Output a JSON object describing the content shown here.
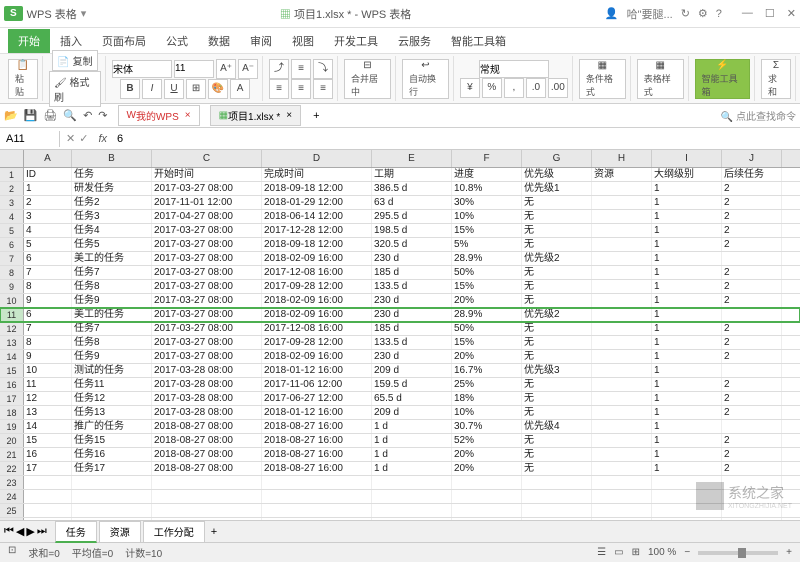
{
  "title": {
    "app_logo": "S",
    "app_name": "WPS 表格",
    "doc_title": "项目1.xlsx * - WPS 表格",
    "user_hint": "哈\"要腿..."
  },
  "menu": {
    "tabs": [
      "开始",
      "插入",
      "页面布局",
      "公式",
      "数据",
      "审阅",
      "视图",
      "开发工具",
      "云服务",
      "智能工具箱"
    ],
    "active_index": 0
  },
  "toolbar": {
    "paste": "粘贴",
    "copy": "复制",
    "format_painter": "格式刷",
    "font_name": "宋体",
    "font_size": "11",
    "merge": "合并居中",
    "wrap": "自动换行",
    "general": "常规",
    "cond_format": "条件格式",
    "table_style": "表格样式",
    "smart_tools": "智能工具箱",
    "sum": "求和"
  },
  "quickbar": {
    "home_tab": "我的WPS",
    "doc_tab": "项目1.xlsx *",
    "search_hint": "点此查找命令"
  },
  "formula_bar": {
    "cell_ref": "A11",
    "fx": "fx",
    "value": "6"
  },
  "columns": [
    "A",
    "B",
    "C",
    "D",
    "E",
    "F",
    "G",
    "H",
    "I",
    "J"
  ],
  "headers": {
    "A": "ID",
    "B": "任务",
    "C": "开始时间",
    "D": "完成时间",
    "E": "工期",
    "F": "进度",
    "G": "优先级",
    "H": "资源",
    "I": "大纲级别",
    "J": "后续任务"
  },
  "highlighted_row": 11,
  "active_cell": "A11",
  "rows": [
    {
      "A": "1",
      "B": "研发任务",
      "C": "2017-03-27 08:00",
      "D": "2018-09-18 12:00",
      "E": "386.5 d",
      "F": "10.8%",
      "G": "优先级1",
      "H": "",
      "I": "1",
      "J": "2"
    },
    {
      "A": "2",
      "B": "任务2",
      "C": "2017-11-01 12:00",
      "D": "2018-01-29 12:00",
      "E": "63 d",
      "F": "30%",
      "G": "无",
      "H": "",
      "I": "1",
      "J": "2"
    },
    {
      "A": "3",
      "B": "任务3",
      "C": "2017-04-27 08:00",
      "D": "2018-06-14 12:00",
      "E": "295.5 d",
      "F": "10%",
      "G": "无",
      "H": "",
      "I": "1",
      "J": "2"
    },
    {
      "A": "4",
      "B": "任务4",
      "C": "2017-03-27 08:00",
      "D": "2017-12-28 12:00",
      "E": "198.5 d",
      "F": "15%",
      "G": "无",
      "H": "",
      "I": "1",
      "J": "2"
    },
    {
      "A": "5",
      "B": "任务5",
      "C": "2017-03-27 08:00",
      "D": "2018-09-18 12:00",
      "E": "320.5 d",
      "F": "5%",
      "G": "无",
      "H": "",
      "I": "1",
      "J": "2"
    },
    {
      "A": "6",
      "B": "美工的任务",
      "C": "2017-03-27 08:00",
      "D": "2018-02-09 16:00",
      "E": "230 d",
      "F": "28.9%",
      "G": "优先级2",
      "H": "",
      "I": "1",
      "J": ""
    },
    {
      "A": "7",
      "B": "任务7",
      "C": "2017-03-27 08:00",
      "D": "2017-12-08 16:00",
      "E": "185 d",
      "F": "50%",
      "G": "无",
      "H": "",
      "I": "1",
      "J": "2"
    },
    {
      "A": "8",
      "B": "任务8",
      "C": "2017-03-27 08:00",
      "D": "2017-09-28 12:00",
      "E": "133.5 d",
      "F": "15%",
      "G": "无",
      "H": "",
      "I": "1",
      "J": "2"
    },
    {
      "A": "9",
      "B": "任务9",
      "C": "2017-03-27 08:00",
      "D": "2018-02-09 16:00",
      "E": "230 d",
      "F": "20%",
      "G": "无",
      "H": "",
      "I": "1",
      "J": "2"
    },
    {
      "A": "6",
      "B": "美工的任务",
      "C": "2017-03-27 08:00",
      "D": "2018-02-09 16:00",
      "E": "230 d",
      "F": "28.9%",
      "G": "优先级2",
      "H": "",
      "I": "1",
      "J": ""
    },
    {
      "A": "7",
      "B": "任务7",
      "C": "2017-03-27 08:00",
      "D": "2017-12-08 16:00",
      "E": "185 d",
      "F": "50%",
      "G": "无",
      "H": "",
      "I": "1",
      "J": "2"
    },
    {
      "A": "8",
      "B": "任务8",
      "C": "2017-03-27 08:00",
      "D": "2017-09-28 12:00",
      "E": "133.5 d",
      "F": "15%",
      "G": "无",
      "H": "",
      "I": "1",
      "J": "2"
    },
    {
      "A": "9",
      "B": "任务9",
      "C": "2017-03-27 08:00",
      "D": "2018-02-09 16:00",
      "E": "230 d",
      "F": "20%",
      "G": "无",
      "H": "",
      "I": "1",
      "J": "2"
    },
    {
      "A": "10",
      "B": "测试的任务",
      "C": "2017-03-28 08:00",
      "D": "2018-01-12 16:00",
      "E": "209 d",
      "F": "16.7%",
      "G": "优先级3",
      "H": "",
      "I": "1",
      "J": ""
    },
    {
      "A": "11",
      "B": "任务11",
      "C": "2017-03-28 08:00",
      "D": "2017-11-06 12:00",
      "E": "159.5 d",
      "F": "25%",
      "G": "无",
      "H": "",
      "I": "1",
      "J": "2"
    },
    {
      "A": "12",
      "B": "任务12",
      "C": "2017-03-28 08:00",
      "D": "2017-06-27 12:00",
      "E": "65.5 d",
      "F": "18%",
      "G": "无",
      "H": "",
      "I": "1",
      "J": "2"
    },
    {
      "A": "13",
      "B": "任务13",
      "C": "2017-03-28 08:00",
      "D": "2018-01-12 16:00",
      "E": "209 d",
      "F": "10%",
      "G": "无",
      "H": "",
      "I": "1",
      "J": "2"
    },
    {
      "A": "14",
      "B": "推广的任务",
      "C": "2018-08-27 08:00",
      "D": "2018-08-27 16:00",
      "E": "1 d",
      "F": "30.7%",
      "G": "优先级4",
      "H": "",
      "I": "1",
      "J": ""
    },
    {
      "A": "15",
      "B": "任务15",
      "C": "2018-08-27 08:00",
      "D": "2018-08-27 16:00",
      "E": "1 d",
      "F": "52%",
      "G": "无",
      "H": "",
      "I": "1",
      "J": "2"
    },
    {
      "A": "16",
      "B": "任务16",
      "C": "2018-08-27 08:00",
      "D": "2018-08-27 16:00",
      "E": "1 d",
      "F": "20%",
      "G": "无",
      "H": "",
      "I": "1",
      "J": "2"
    },
    {
      "A": "17",
      "B": "任务17",
      "C": "2018-08-27 08:00",
      "D": "2018-08-27 16:00",
      "E": "1 d",
      "F": "20%",
      "G": "无",
      "H": "",
      "I": "1",
      "J": "2"
    }
  ],
  "empty_rows": [
    23,
    24,
    25,
    26,
    27
  ],
  "sheets": {
    "tabs": [
      "任务",
      "资源",
      "工作分配"
    ],
    "active_index": 0
  },
  "statusbar": {
    "sum": "求和=0",
    "avg": "平均值=0",
    "count": "计数=10",
    "zoom": "100 %"
  },
  "watermark": "系统之家",
  "url_hint": "XITONGZHIJIA.NET"
}
